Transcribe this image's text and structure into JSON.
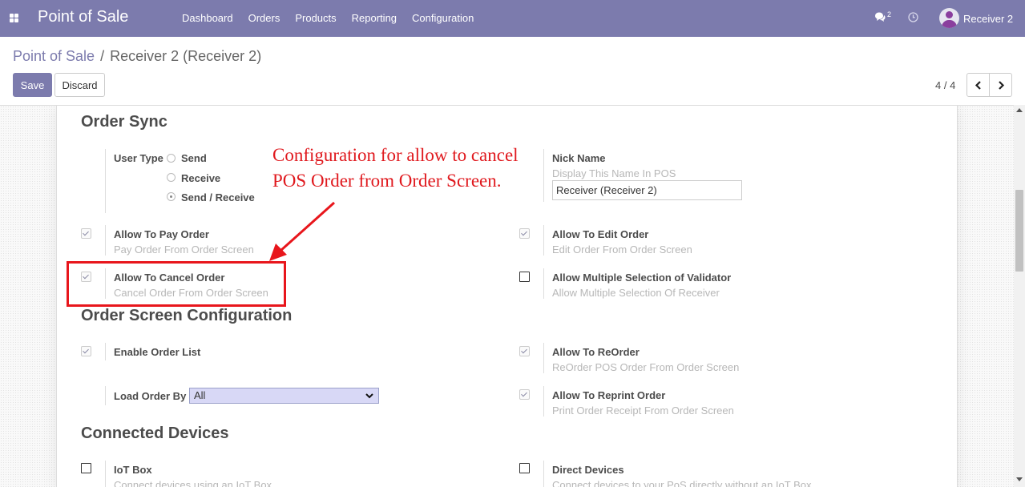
{
  "navbar": {
    "brand": "Point of Sale",
    "menu": [
      "Dashboard",
      "Orders",
      "Products",
      "Reporting",
      "Configuration"
    ],
    "chat_count": "2",
    "user": "Receiver 2",
    "icons": [
      "apps-icon",
      "chat-icon",
      "clock-icon",
      "avatar"
    ]
  },
  "breadcrumb": {
    "parent": "Point of Sale",
    "separator": "/",
    "current": "Receiver 2 (Receiver 2)"
  },
  "toolbar": {
    "save": "Save",
    "discard": "Discard",
    "pager": "4 / 4"
  },
  "order_sync": {
    "title": "Order Sync",
    "user_type": {
      "label": "User Type",
      "options": [
        "Send",
        "Receive",
        "Send / Receive"
      ],
      "selected": "Send / Receive"
    },
    "nick_name": {
      "label": "Nick Name",
      "help": "Display This Name In POS",
      "value": "Receiver (Receiver 2)"
    },
    "allow_pay": {
      "label": "Allow To Pay Order",
      "help": "Pay Order From Order Screen",
      "checked": true
    },
    "allow_edit": {
      "label": "Allow To Edit Order",
      "help": "Edit Order From Order Screen",
      "checked": true
    },
    "allow_cancel": {
      "label": "Allow To Cancel Order",
      "help": "Cancel Order From Order Screen",
      "checked": true
    },
    "allow_multi": {
      "label": "Allow Multiple Selection of Validator",
      "help": "Allow Multiple Selection Of Receiver",
      "checked": false
    }
  },
  "order_screen": {
    "title": "Order Screen Configuration",
    "enable_list": {
      "label": "Enable Order List",
      "checked": true
    },
    "allow_reorder": {
      "label": "Allow To ReOrder",
      "help": "ReOrder POS Order From Order Screen",
      "checked": true
    },
    "load_order_by": {
      "label": "Load Order By",
      "value": "All"
    },
    "allow_reprint": {
      "label": "Allow To Reprint Order",
      "help": "Print Order Receipt From Order Screen",
      "checked": true
    }
  },
  "connected_devices": {
    "title": "Connected Devices",
    "iot_box": {
      "label": "IoT Box",
      "help": "Connect devices using an IoT Box",
      "checked": false
    },
    "direct_devices": {
      "label": "Direct Devices",
      "help": "Connect devices to your PoS directly without an IoT Box",
      "checked": false
    }
  },
  "annotation": {
    "line1": "Configuration for allow to cancel",
    "line2": "POS Order from Order Screen.",
    "color": "#e0191e"
  },
  "colors": {
    "brand": "#7c7bad",
    "annotation": "#e8161c"
  }
}
